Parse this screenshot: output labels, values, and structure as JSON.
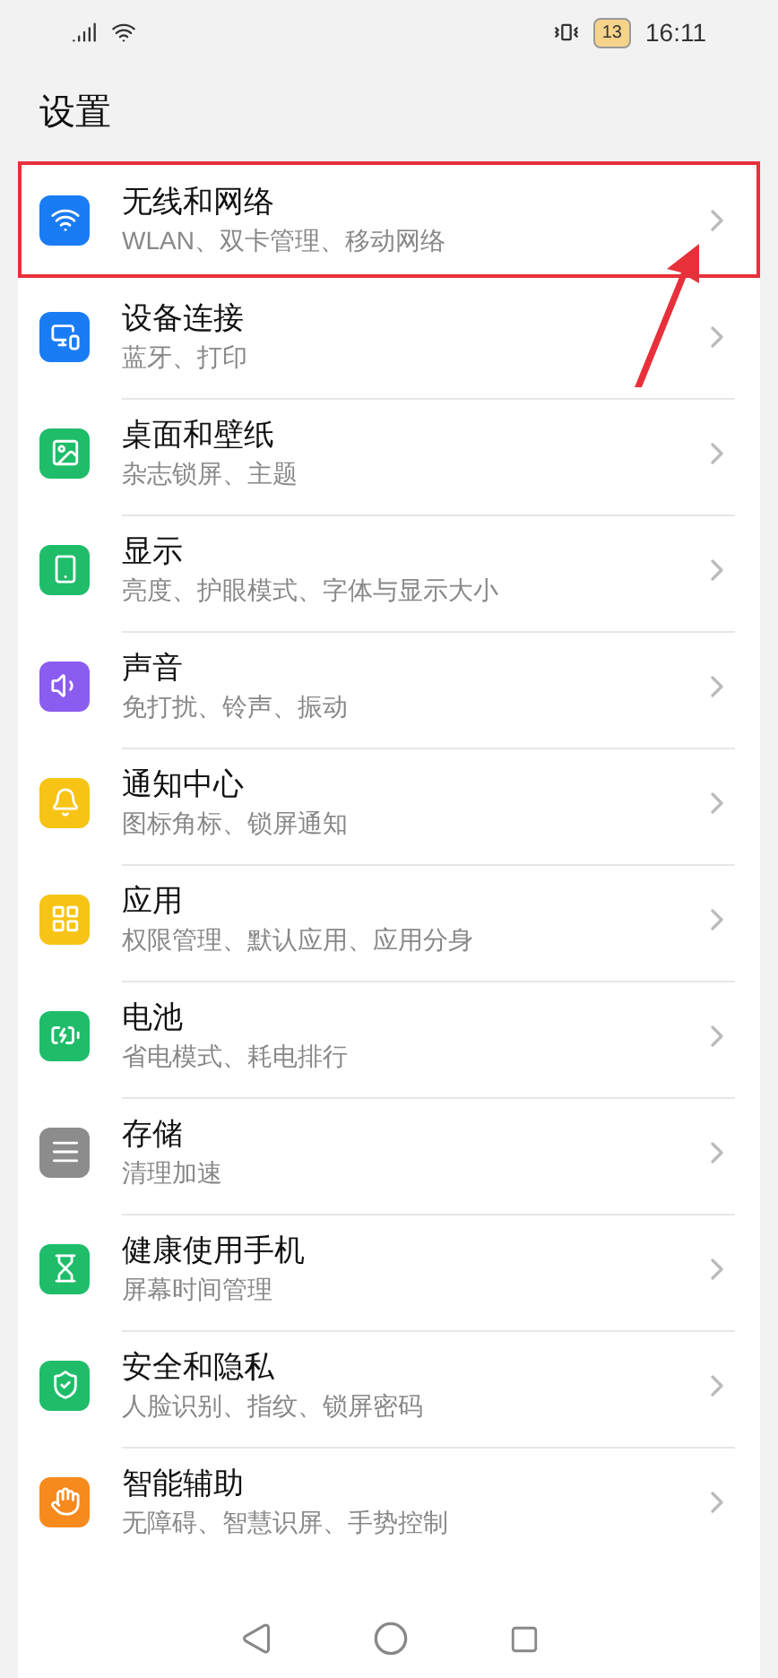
{
  "status_bar": {
    "battery": "13",
    "time": "16:11"
  },
  "title": "设置",
  "items": [
    {
      "title": "无线和网络",
      "subtitle": "WLAN、双卡管理、移动网络",
      "color": "#1a7cf5",
      "highlighted": true
    },
    {
      "title": "设备连接",
      "subtitle": "蓝牙、打印",
      "color": "#1a7cf5",
      "highlighted": false
    },
    {
      "title": "桌面和壁纸",
      "subtitle": "杂志锁屏、主题",
      "color": "#1fbd6a",
      "highlighted": false
    },
    {
      "title": "显示",
      "subtitle": "亮度、护眼模式、字体与显示大小",
      "color": "#1fbd6a",
      "highlighted": false
    },
    {
      "title": "声音",
      "subtitle": "免打扰、铃声、振动",
      "color": "#8a5cf0",
      "highlighted": false
    },
    {
      "title": "通知中心",
      "subtitle": "图标角标、锁屏通知",
      "color": "#f7c416",
      "highlighted": false
    },
    {
      "title": "应用",
      "subtitle": "权限管理、默认应用、应用分身",
      "color": "#f7c416",
      "highlighted": false
    },
    {
      "title": "电池",
      "subtitle": "省电模式、耗电排行",
      "color": "#1fbd6a",
      "highlighted": false
    },
    {
      "title": "存储",
      "subtitle": "清理加速",
      "color": "#8c8c8c",
      "highlighted": false
    },
    {
      "title": "健康使用手机",
      "subtitle": "屏幕时间管理",
      "color": "#1fbd6a",
      "highlighted": false
    },
    {
      "title": "安全和隐私",
      "subtitle": "人脸识别、指纹、锁屏密码",
      "color": "#1fbd6a",
      "highlighted": false
    },
    {
      "title": "智能辅助",
      "subtitle": "无障碍、智慧识屏、手势控制",
      "color": "#f78a1d",
      "highlighted": false
    }
  ]
}
